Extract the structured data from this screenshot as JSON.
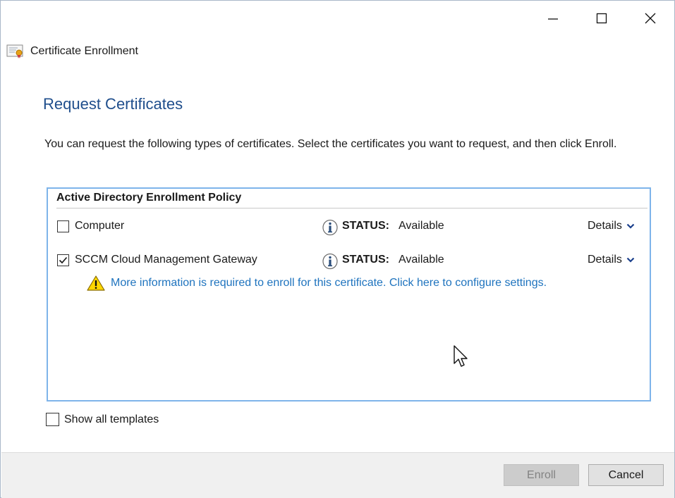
{
  "window": {
    "title": "Certificate Enrollment",
    "controls": [
      "minimize-icon",
      "maximize-icon",
      "close-icon"
    ]
  },
  "page": {
    "heading": "Request Certificates",
    "intro": "You can request the following types of certificates. Select the certificates you want to request, and then click Enroll."
  },
  "policy": {
    "title": "Active Directory Enrollment Policy",
    "certificates": [
      {
        "name": "Computer",
        "checked": false,
        "status_label": "STATUS:",
        "status_value": "Available",
        "details_label": "Details"
      },
      {
        "name": "SCCM Cloud Management Gateway",
        "checked": true,
        "status_label": "STATUS:",
        "status_value": "Available",
        "details_label": "Details",
        "warning": "More information is required to enroll for this certificate. Click here to configure settings."
      }
    ]
  },
  "options": {
    "show_all_templates_label": "Show all templates",
    "show_all_templates_checked": false
  },
  "buttons": {
    "enroll": "Enroll",
    "enroll_enabled": false,
    "cancel": "Cancel"
  },
  "colors": {
    "heading": "#1f4e8c",
    "link": "#1e73be",
    "box_border": "#7eb4ea"
  }
}
